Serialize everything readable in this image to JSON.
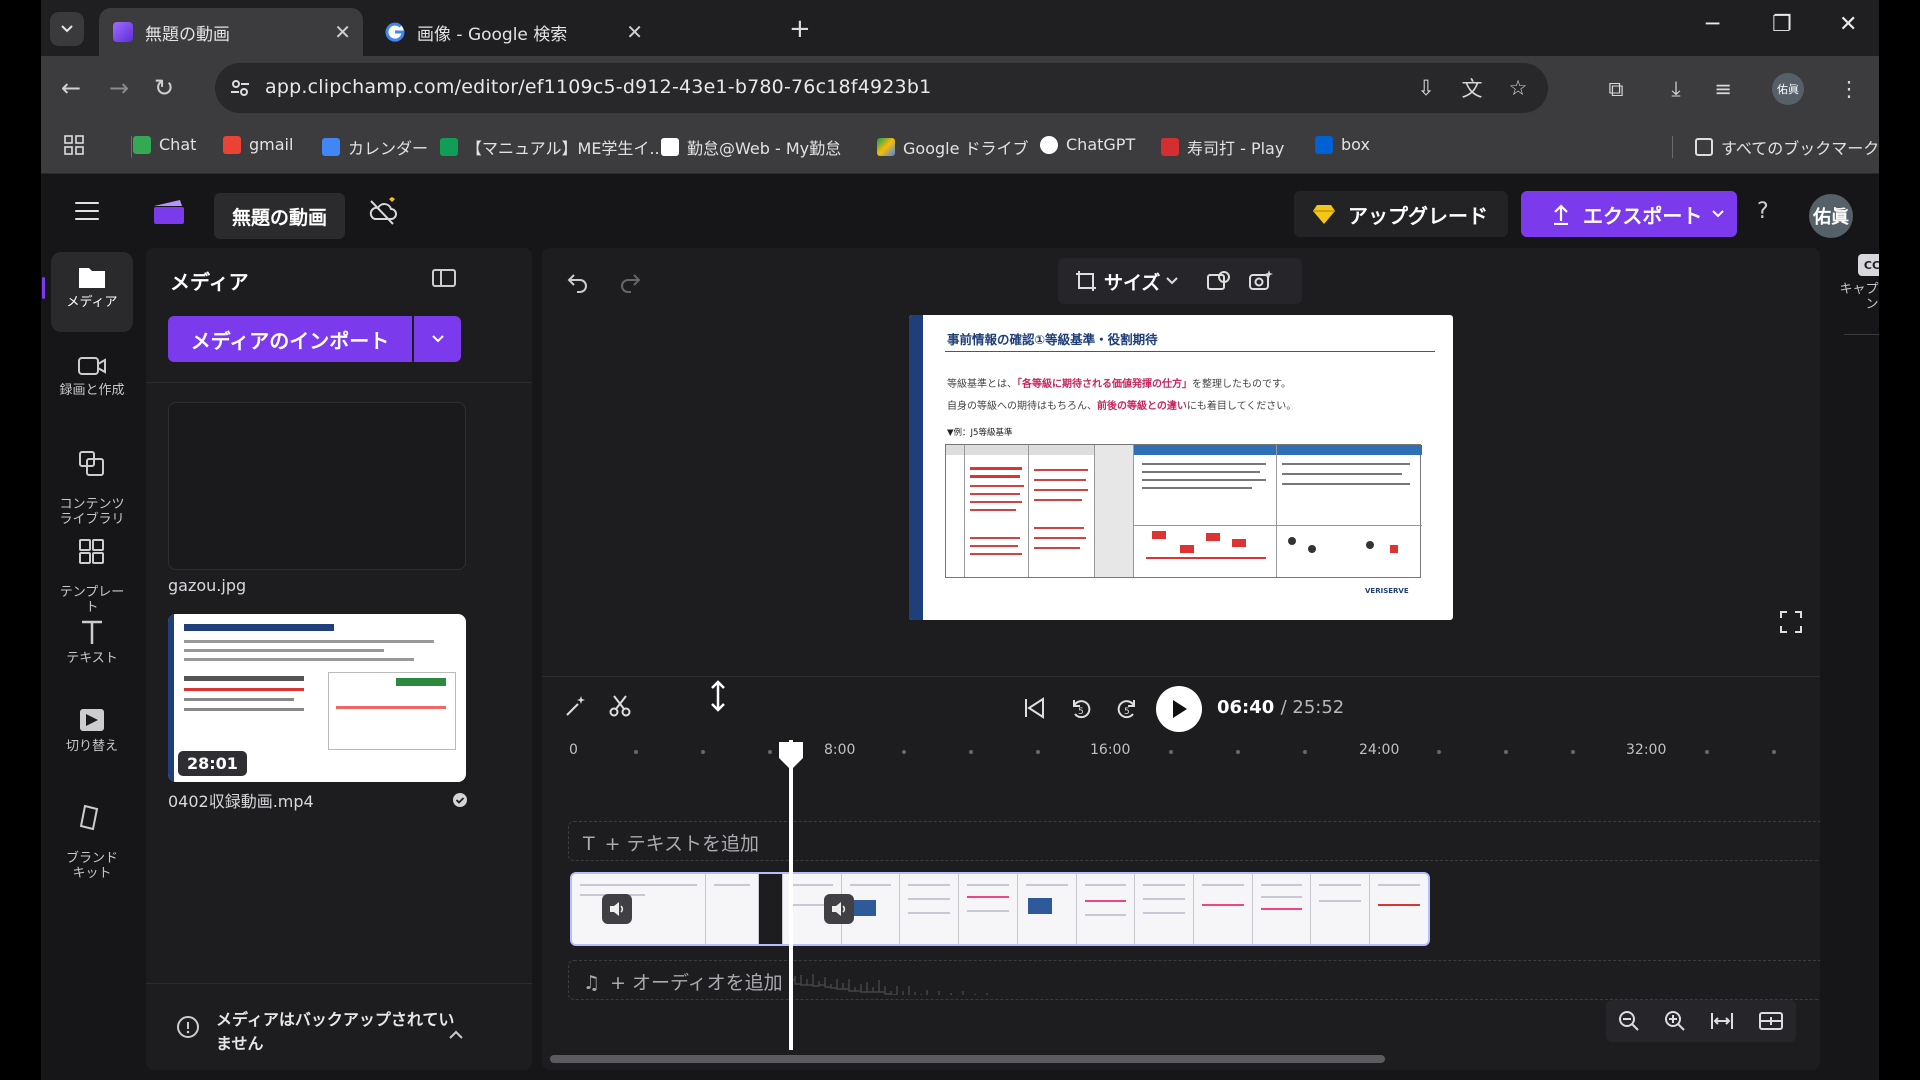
{
  "browser": {
    "tabs": [
      {
        "title": "無題の動画",
        "active": true
      },
      {
        "title": "画像 - Google 検索",
        "active": false
      }
    ],
    "url": "app.clipchamp.com/editor/ef1109c5-d912-43e1-b780-76c18f4923b1",
    "profile_initials": "佑眞",
    "bookmarks": [
      {
        "label": "Chat",
        "color": "#34a853"
      },
      {
        "label": "gmail",
        "color": "#ea4335"
      },
      {
        "label": "カレンダー",
        "color": "#4285f4"
      },
      {
        "label": "【マニュアル】ME学生イ...",
        "color": "#0f9d58"
      },
      {
        "label": "勤怠@Web - My勤怠",
        "color": "#ffffff"
      },
      {
        "label": "Google ドライブ",
        "color": "#fbbc04"
      },
      {
        "label": "ChatGPT",
        "color": "#ffffff"
      },
      {
        "label": "寿司打 - Play",
        "color": "#d32f2f"
      },
      {
        "label": "box",
        "color": "#0061d5"
      }
    ],
    "all_bookmarks_label": "すべてのブックマーク"
  },
  "app": {
    "project_title": "無題の動画",
    "upgrade_label": "アップグレード",
    "export_label": "エクスポート",
    "help_label": "?",
    "user_initials": "佑眞",
    "accent_color": "#7c3aed"
  },
  "rail": [
    {
      "label": "メディア",
      "icon": "folder-icon",
      "active": true
    },
    {
      "label": "録画と作成",
      "icon": "camera-icon"
    },
    {
      "label": "コンテンツ\nライブラリ",
      "icon": "content-library-icon"
    },
    {
      "label": "テンプレー\nト",
      "icon": "template-icon"
    },
    {
      "label": "テキスト",
      "icon": "text-icon"
    },
    {
      "label": "切り替え",
      "icon": "transition-icon"
    },
    {
      "label": "ブランド\nキット",
      "icon": "brand-kit-icon"
    }
  ],
  "media_panel": {
    "title": "メディア",
    "import_label": "メディアのインポート",
    "items": [
      {
        "name": "gazou.jpg",
        "duration": ""
      },
      {
        "name": "0402収録動画.mp4",
        "duration": "28:01"
      }
    ],
    "backup_notice": "メディアはバックアップされていません"
  },
  "preview": {
    "size_label": "サイズ",
    "slide": {
      "heading": "事前情報の確認①等級基準・役割期待",
      "line1_pre": "等級基準とは、",
      "line1_em": "「各等級に期待される価値発揮の仕方」",
      "line1_post": "を整理したものです。",
      "line2_pre": "自身の等級への期待はもちろん、",
      "line2_em": "前後の等級との違い",
      "line2_post": "にも着目してください。",
      "example": "▼例：J5等級基準",
      "logo": "VERISERVE"
    }
  },
  "playback": {
    "current_time": "06:40",
    "total_time": "/ 25:52",
    "progress": 0.258
  },
  "timeline": {
    "ruler_labels": [
      "0",
      "8:00",
      "16:00",
      "24:00",
      "32:00"
    ],
    "add_text_label": "+ テキストを追加",
    "add_audio_label": "+ オーディオを追加"
  },
  "right_rail": {
    "caption_label": "キャプショ\nン",
    "caption_badge": "CC"
  }
}
